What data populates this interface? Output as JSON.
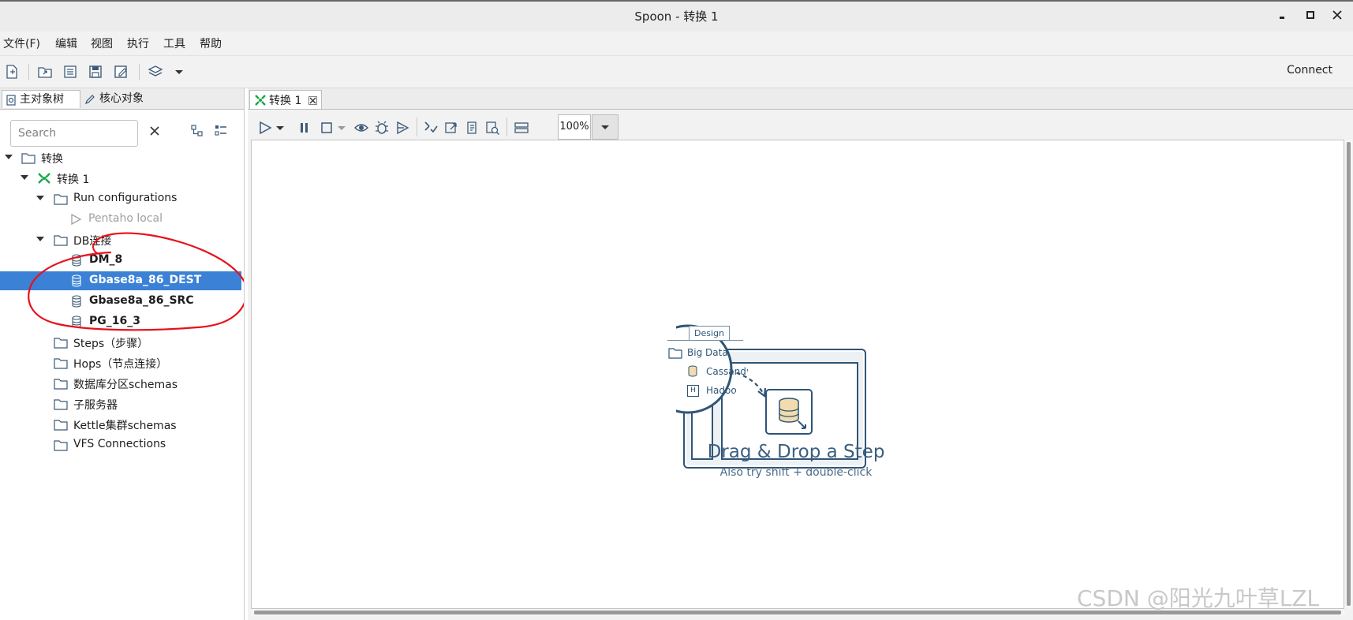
{
  "window": {
    "title": "Spoon - 转换 1",
    "controls": {
      "minimize": "▪",
      "maximize": "▫",
      "close": "✕"
    }
  },
  "menubar": {
    "items": [
      "文件(F)",
      "编辑",
      "视图",
      "执行",
      "工具",
      "帮助"
    ]
  },
  "toolbar": {
    "icons": [
      "new-file-icon",
      "open-folder-icon",
      "explore-repository-icon",
      "save-icon",
      "save-as-icon",
      "layers-icon",
      "dropdown-arrow-icon"
    ],
    "connect_label": "Connect"
  },
  "left_panel": {
    "tabs": [
      "主对象树",
      "核心对象"
    ],
    "search_placeholder": "Search",
    "tree": {
      "root": "转换",
      "trans": "转换 1",
      "run_configs": "Run configurations",
      "pentaho_local": "Pentaho local",
      "db_connections": "DB连接",
      "db_items": [
        "DM_8",
        "Gbase8a_86_DEST",
        "Gbase8a_86_SRC",
        "PG_16_3"
      ],
      "selected_db": "Gbase8a_86_DEST",
      "steps": "Steps（步骤）",
      "hops": "Hops（节点连接）",
      "partition": "数据库分区schemas",
      "slave": "子服务器",
      "cluster": "Kettle集群schemas",
      "vfs": "VFS Connections"
    }
  },
  "editor": {
    "tab_label": "转换 1",
    "zoom": "100%",
    "illustration": {
      "design_tab": "Design",
      "big_data": "Big Data",
      "cassandra": "Cassandr",
      "hadoop": "Hadoo",
      "hadoop_badge": "H"
    },
    "drag_drop_title": "Drag & Drop a Step",
    "drag_drop_sub": "Also try shift + double-click"
  },
  "colors": {
    "selection": "#3b82d6",
    "annotation_red": "#e8101a",
    "illustration_blue": "#2f5577",
    "run_icon_green": "#1aa84a"
  },
  "watermark": "CSDN @阳光九叶草LZL"
}
